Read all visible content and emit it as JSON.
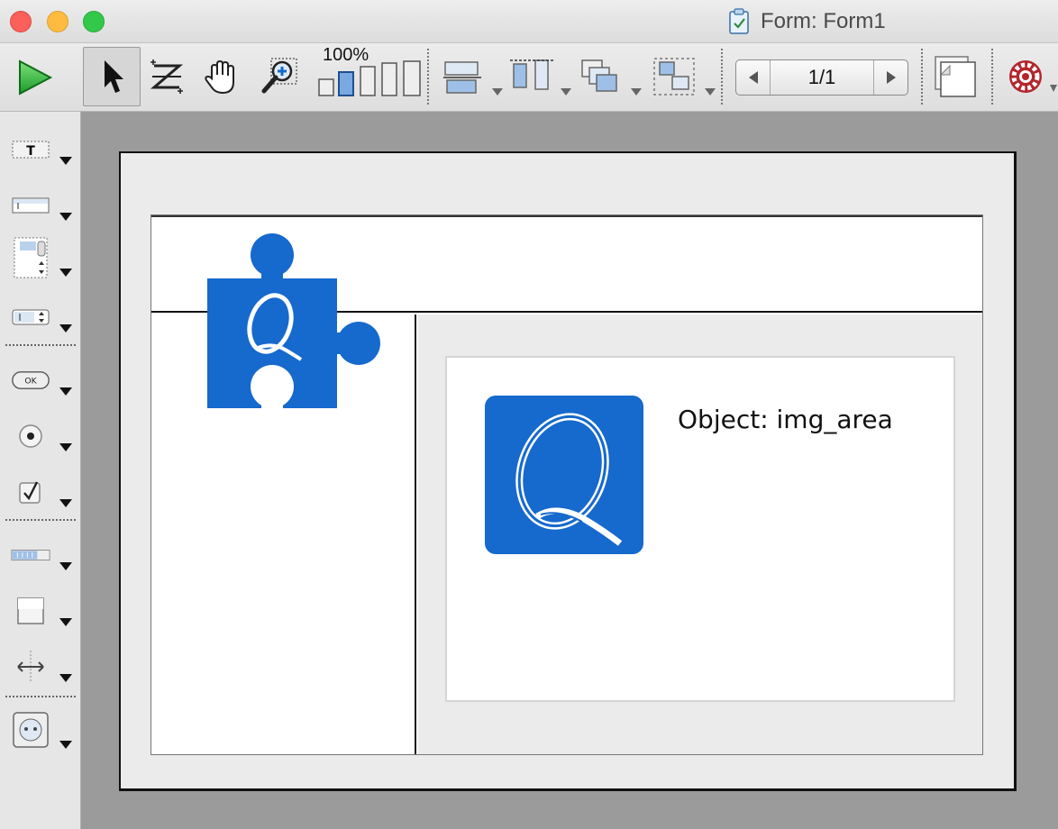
{
  "window": {
    "title": "Form: Form1"
  },
  "toolbar": {
    "zoom_level": "100%",
    "page_indicator": "1/1",
    "icons": [
      "run-triangle-icon",
      "select-arrow-icon",
      "entry-order-icon",
      "hand-scroll-icon",
      "zoom-magnifier-icon",
      "zoom-level-bars-icon",
      "align-icon",
      "distribute-icon",
      "layer-order-icon",
      "group-icon",
      "previous-page-icon",
      "next-page-icon",
      "pages-icon",
      "settings-gear-icon"
    ]
  },
  "object_library": {
    "tools": [
      "text-icon",
      "input-field-icon",
      "list-box-icon",
      "stepper-icon",
      "button-icon",
      "radio-button-icon",
      "checkbox-icon",
      "progress-bar-icon",
      "rectangle-icon",
      "splitter-icon",
      "web-area-icon"
    ]
  },
  "form": {
    "object_label": "Object: img_area"
  },
  "colors": {
    "accent_blue": "#1669cd",
    "page_bg": "#ebebeb",
    "canvas_bg": "#9b9b9b"
  }
}
